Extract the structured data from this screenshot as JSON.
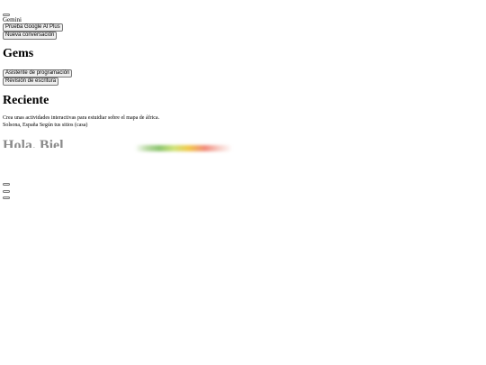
{
  "app": {
    "name": "Gemini"
  },
  "sidebar": {
    "upgrade_label": "Prueba Google AI Plus",
    "new_chat_label": "Nueva conversación",
    "gems_title": "Gems",
    "gems": [
      {
        "label": "Asistente de programación"
      },
      {
        "label": "Revisión de escritura"
      }
    ],
    "recent_title": "Reciente",
    "recent_items": [
      {
        "label": "Crea unas actividades interactivas para estuidiar sobre el mapa de áfrica."
      }
    ],
    "location": "Solsona, España Según tus sitios (casa)"
  },
  "main": {
    "greeting": "Hola, Biel"
  }
}
